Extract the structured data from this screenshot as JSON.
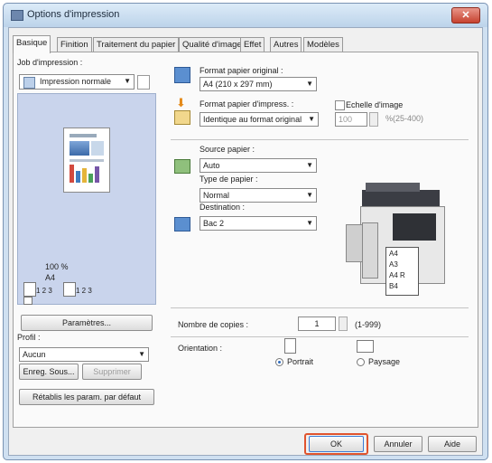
{
  "window": {
    "title": "Options d'impression",
    "close_label": "✕"
  },
  "tabs": [
    "Basique",
    "Finition",
    "Traitement du papier",
    "Qualité d'image",
    "Effet",
    "Autres",
    "Modèles"
  ],
  "left": {
    "job_label": "Job d'impression :",
    "job_value": "Impression normale",
    "preview_pct": "100 %",
    "preview_size": "A4",
    "preview_collate1": "1 2 3",
    "preview_collate2": "1 2 3",
    "params_button": "Paramètres...",
    "profile_label": "Profil :",
    "profile_value": "Aucun",
    "save_button": "Enreg. Sous...",
    "delete_button": "Supprimer",
    "reset_button": "Rétablis les param. par défaut"
  },
  "paper": {
    "original_label": "Format papier original :",
    "original_value": "A4 (210 x 297 mm)",
    "print_label": "Format papier d'impress. :",
    "print_value": "Identique au format original",
    "scale_label": "Echelle d'image",
    "scale_value": "100",
    "scale_range": "%(25-400)",
    "source_label": "Source papier :",
    "source_value": "Auto",
    "type_label": "Type de papier :",
    "type_value": "Normal",
    "dest_label": "Destination :",
    "dest_value": "Bac 2",
    "tray_labels": [
      "A4",
      "A3",
      "A4 R",
      "B4"
    ]
  },
  "copies": {
    "label": "Nombre de copies :",
    "value": "1",
    "range": "(1-999)"
  },
  "orientation": {
    "label": "Orientation :",
    "portrait": "Portrait",
    "landscape": "Paysage",
    "selected": "portrait"
  },
  "footer": {
    "ok": "OK",
    "cancel": "Annuler",
    "help": "Aide"
  },
  "colors": {
    "highlight": "#e0542e",
    "preview_bg": "#c9d4ec",
    "accent": "#4f86c6"
  }
}
